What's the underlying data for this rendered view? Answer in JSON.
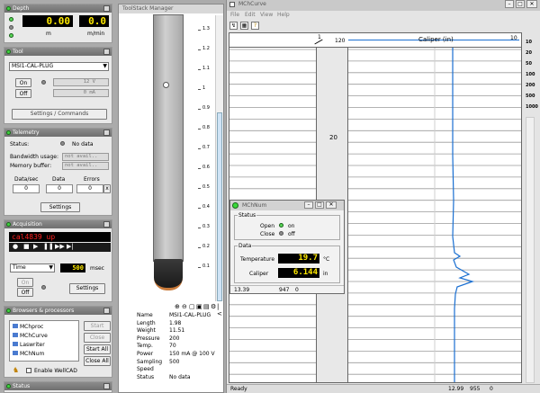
{
  "depth": {
    "title": "Depth",
    "value": "0.00",
    "rate": "0.0",
    "unit1": "m",
    "unit2": "m/min"
  },
  "tool": {
    "title": "Tool",
    "selected": "MSI1-CAL-PLUG",
    "on_label": "On",
    "off_label": "Off",
    "voltage": "12 V",
    "current": "0 mA",
    "settings_label": "Settings / Commands"
  },
  "telemetry": {
    "title": "Telemetry",
    "status_label": "Status:",
    "status_value": "No data",
    "bandwidth_label": "Bandwidth usage:",
    "bandwidth_value": "not avail..",
    "memory_label": "Memory buffer:",
    "memory_value": "not avail..",
    "cols": [
      "Data/sec",
      "Data",
      "Errors"
    ],
    "vals": [
      "0",
      "0",
      "0"
    ],
    "x_label": "x",
    "settings_label": "Settings"
  },
  "acquisition": {
    "title": "Acquisition",
    "lcd": "cal4839 up",
    "mode": "Time",
    "interval": "500",
    "interval_unit": "msec",
    "on_label": "On",
    "off_label": "Off",
    "settings_label": "Settings"
  },
  "browsers": {
    "title": "Browsers & processors",
    "items": [
      "MChproc",
      "MChCurve",
      "Laswriter",
      "MChNum"
    ],
    "buttons": [
      "Start",
      "Close",
      "Start All",
      "Close All"
    ],
    "enable_label": "Enable WellCAD"
  },
  "status_panel": {
    "title": "Status"
  },
  "toolstack": {
    "title": "ToolStack Manager",
    "ticks": [
      "1.3",
      "1.2",
      "1.1",
      "1",
      "0.9",
      "0.8",
      "0.7",
      "0.6",
      "0.5",
      "0.4",
      "0.3",
      "0.2",
      "0.1"
    ],
    "props": [
      {
        "k": "Name",
        "v": "MSI1-CAL-PLUG"
      },
      {
        "k": "Length",
        "v": "1.98"
      },
      {
        "k": "Weight",
        "v": "11.51"
      },
      {
        "k": "Pressure",
        "v": "200"
      },
      {
        "k": "Temp.",
        "v": "70"
      },
      {
        "k": "Power",
        "v": "150 mA @ 100 V"
      },
      {
        "k": "Sampling",
        "v": "500"
      },
      {
        "k": "Speed",
        "v": ""
      },
      {
        "k": "Status",
        "v": "No data"
      }
    ]
  },
  "mchcurve": {
    "title": "MChCurve",
    "menu": [
      "File",
      "Edit",
      "View",
      "Help"
    ],
    "track_header_depth": "1",
    "scale_left": "120",
    "scale_right": "10",
    "curve_label": "Caliper (in)",
    "depth_label": "20",
    "zoom": [
      "10",
      "20",
      "50",
      "100",
      "200",
      "500",
      "1000"
    ],
    "status": "Ready",
    "status_fields": [
      "12.99",
      "955",
      "0"
    ],
    "curve_color": "#1a6fd1"
  },
  "mchnum": {
    "title": "MChNum",
    "status_group": "Status",
    "open_label": "Open",
    "open_value": "on",
    "close_label": "Close",
    "close_value": "off",
    "data_group": "Data",
    "temp_label": "Temperature",
    "temp_value": "19.7",
    "temp_unit": "°C",
    "cal_label": "Caliper",
    "cal_value": "6.144",
    "cal_unit": "in",
    "footer": [
      "13.39",
      "947",
      "0"
    ]
  }
}
